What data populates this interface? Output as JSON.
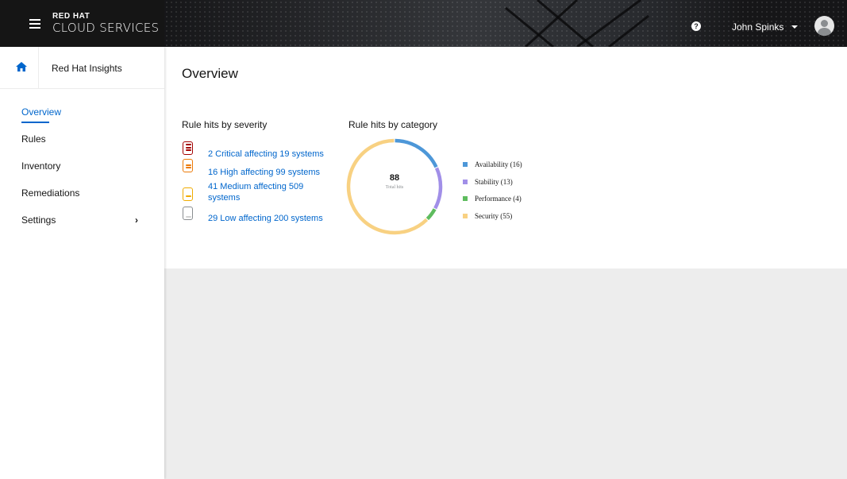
{
  "header": {
    "brand_top": "RED HAT",
    "brand_bottom": "CLOUD SERVICES",
    "help_glyph": "?",
    "user_name": "John Spinks"
  },
  "sidebar": {
    "app_name": "Red Hat Insights",
    "items": [
      {
        "label": "Overview",
        "active": true
      },
      {
        "label": "Rules"
      },
      {
        "label": "Inventory"
      },
      {
        "label": "Remediations"
      },
      {
        "label": "Settings",
        "chevron": "›"
      }
    ]
  },
  "main": {
    "page_title": "Overview",
    "severity": {
      "title": "Rule hits by severity",
      "items": [
        {
          "level": "critical",
          "link": "2 Critical affecting 19 systems",
          "color": "#a30000"
        },
        {
          "level": "high",
          "link": "16 High affecting 99 systems",
          "color": "#ec7a08"
        },
        {
          "level": "medium",
          "link": "41 Medium affecting 509 systems",
          "color": "#f0ab00"
        },
        {
          "level": "low",
          "link": "29 Low affecting 200 systems",
          "color": "#8a8d90"
        }
      ]
    },
    "category": {
      "title": "Rule hits by category",
      "total_value": "88",
      "total_label": "Total hits"
    }
  },
  "chart_data": {
    "type": "pie",
    "title": "Rule hits by category",
    "categories": [
      "Availability",
      "Stability",
      "Performance",
      "Security"
    ],
    "values": [
      16,
      13,
      4,
      55
    ],
    "legend_labels": [
      "Availability (16)",
      "Stability (13)",
      "Performance (4)",
      "Security (55)"
    ],
    "colors": [
      "#4d97d8",
      "#a18fe8",
      "#5ebc5e",
      "#f8d182"
    ],
    "total": 88,
    "legend_position": "right"
  }
}
